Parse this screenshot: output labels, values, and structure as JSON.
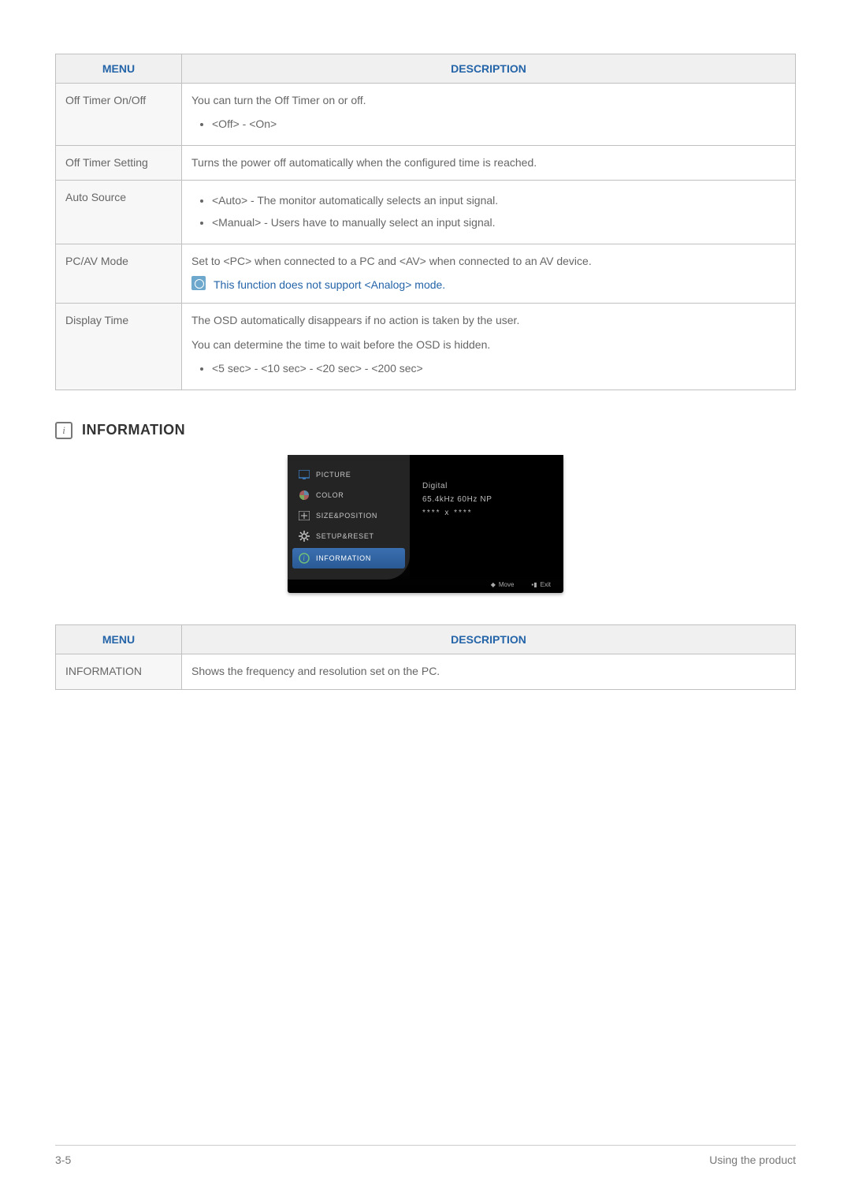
{
  "table1": {
    "headers": {
      "menu": "MENU",
      "description": "DESCRIPTION"
    },
    "rows": [
      {
        "menu": "Off Timer On/Off",
        "text": "You can turn the Off Timer on or off.",
        "options": "<Off> - <On>"
      },
      {
        "menu": "Off Timer Setting",
        "text": "Turns the power off automatically when the configured time is reached."
      },
      {
        "menu": "Auto Source",
        "bullet1": "<Auto> - The monitor automatically selects an input signal.",
        "bullet2": "<Manual> - Users have to manually select an input signal."
      },
      {
        "menu": "PC/AV Mode",
        "text": "Set to <PC> when connected to a PC and <AV> when connected to an AV device.",
        "note": "This function does not support <Analog> mode."
      },
      {
        "menu": "Display Time",
        "text1": "The OSD automatically disappears if no action is taken by the user.",
        "text2": "You can determine the time to wait before the OSD is hidden.",
        "options": "<5 sec> - <10 sec> - <20 sec> - <200 sec>"
      }
    ]
  },
  "section_information": {
    "title": "INFORMATION"
  },
  "osd": {
    "menu": {
      "picture": "PICTURE",
      "color": "COLOR",
      "size_position": "SIZE&POSITION",
      "setup_reset": "SETUP&RESET",
      "information": "INFORMATION"
    },
    "info": {
      "signal": "Digital",
      "freq": "65.4kHz 60Hz NP",
      "res": "**** x ****"
    },
    "footer": {
      "move": "Move",
      "exit": "Exit"
    }
  },
  "table2": {
    "headers": {
      "menu": "MENU",
      "description": "DESCRIPTION"
    },
    "row": {
      "menu": "INFORMATION",
      "text": "Shows the frequency and resolution set on the PC."
    }
  },
  "footer": {
    "page": "3-5",
    "section": "Using the product"
  }
}
